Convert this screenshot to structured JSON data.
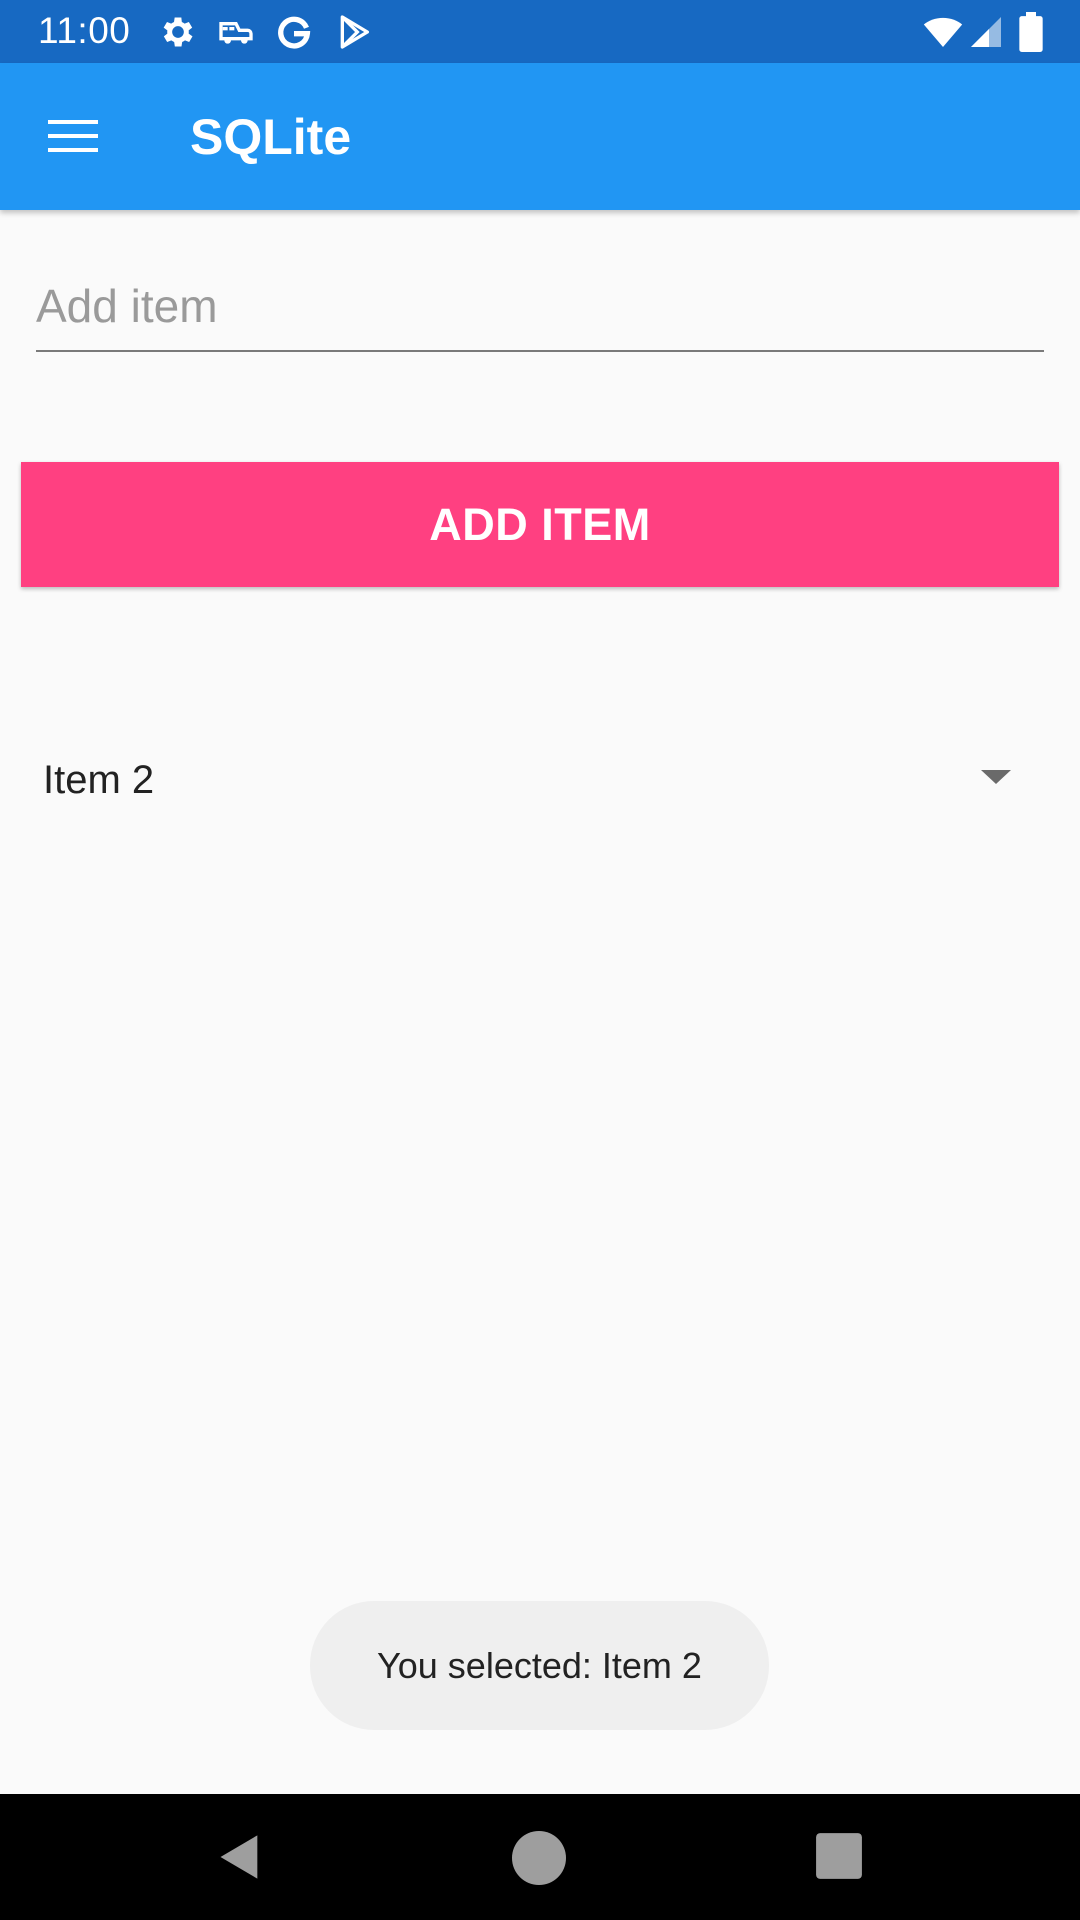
{
  "status_bar": {
    "time": "11:00",
    "icons": [
      "gear-icon",
      "car-icon",
      "google-g-icon",
      "play-store-icon",
      "wifi-icon",
      "signal-icon",
      "battery-icon"
    ]
  },
  "app_bar": {
    "title": "SQLite",
    "menu_icon": "hamburger-menu-icon"
  },
  "entry": {
    "value": "",
    "placeholder": "Add item"
  },
  "add_button": {
    "label": "ADD ITEM"
  },
  "picker": {
    "selected": "Item 2",
    "arrow_icon": "dropdown-arrow-icon"
  },
  "toast": {
    "message": "You selected: Item 2"
  },
  "nav_bar": {
    "icons": [
      "back-icon",
      "home-icon",
      "recents-icon"
    ]
  },
  "colors": {
    "status_bar": "#1769c2",
    "app_bar": "#2196f3",
    "accent": "#ff4081",
    "background": "#fafafa",
    "toast_bg": "#efefef"
  }
}
